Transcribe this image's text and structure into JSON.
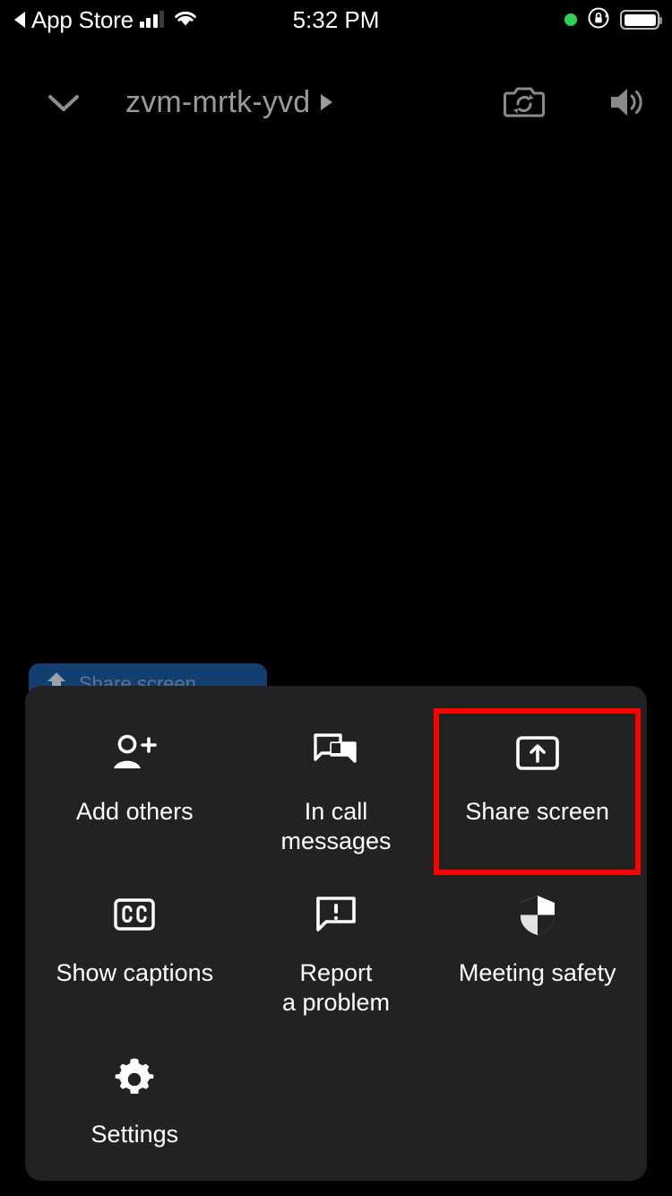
{
  "status_bar": {
    "back_app_label": "App Store",
    "back_icon": "back-triangle-icon",
    "signal_icon": "cellular-signal-icon",
    "wifi_icon": "wifi-icon",
    "time": "5:32 PM",
    "recording_indicator_icon": "green-recording-dot-icon",
    "rotation_lock_icon": "rotation-lock-icon",
    "battery_icon": "battery-full-icon",
    "recording_dot_color": "#30d158"
  },
  "meeting_header": {
    "collapse_icon": "chevron-down-icon",
    "meeting_id": "zvm-mrtk-yvd",
    "details_arrow_icon": "chevron-right-icon",
    "switch_camera_icon": "switch-camera-icon",
    "speaker_icon": "speaker-volume-icon",
    "title_color": "#9a9a9a"
  },
  "share_banner": {
    "icon": "share-screen-up-arrow-icon",
    "label": "Share screen",
    "background_color": "#123f70"
  },
  "action_sheet": {
    "background_color": "#222222",
    "highlight_color": "#ff0000",
    "items": [
      {
        "id": "add-others",
        "icon": "person-add-icon",
        "label": "Add others",
        "highlighted": false
      },
      {
        "id": "in-call-messages",
        "icon": "chat-bubbles-icon",
        "label": "In call\nmessages",
        "highlighted": false
      },
      {
        "id": "share-screen",
        "icon": "share-screen-icon",
        "label": "Share screen",
        "highlighted": true
      },
      {
        "id": "show-captions",
        "icon": "closed-caption-icon",
        "label": "Show captions",
        "highlighted": false
      },
      {
        "id": "report-problem",
        "icon": "report-problem-icon",
        "label": "Report\na problem",
        "highlighted": false
      },
      {
        "id": "meeting-safety",
        "icon": "shield-icon",
        "label": "Meeting safety",
        "highlighted": false
      },
      {
        "id": "settings",
        "icon": "gear-icon",
        "label": "Settings",
        "highlighted": false
      }
    ]
  }
}
